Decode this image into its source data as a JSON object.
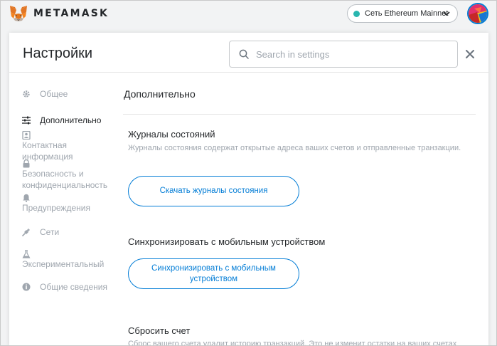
{
  "app": {
    "wordmark": "METAMASK"
  },
  "network": {
    "label": "Сеть Ethereum Mainnet",
    "status_color": "#29b6af"
  },
  "header": {
    "title": "Настройки",
    "search_placeholder": "Search in settings"
  },
  "sidebar": {
    "items": [
      {
        "label": "Общее",
        "icon": "gear-icon"
      },
      {
        "label": "Дополнительно",
        "icon": "sliders-icon"
      },
      {
        "label": "Контактная информация",
        "icon": "contacts-icon"
      },
      {
        "label": "Безопасность и конфиденциальность",
        "icon": "lock-icon"
      },
      {
        "label": "Предупреждения",
        "icon": "bell-icon"
      },
      {
        "label": "Сети",
        "icon": "plug-icon"
      },
      {
        "label": "Экспериментальный",
        "icon": "flask-icon"
      },
      {
        "label": "Общие сведения",
        "icon": "info-icon"
      }
    ]
  },
  "content": {
    "section_title": "Дополнительно",
    "state_logs": {
      "title": "Журналы состояний",
      "description": "Журналы состояния содержат открытые адреса ваших счетов и отправленные транзакции.",
      "button": "Скачать журналы состояния"
    },
    "mobile_sync": {
      "title": "Синхронизировать с мобильным устройством",
      "button": "Синхронизировать с мобильным устройством"
    },
    "reset_account": {
      "title": "Сбросить счет",
      "description": "Сброс вашего счета удалит историю транзакций. Это не изменит остатки на ваших счетах"
    }
  },
  "colors": {
    "accent": "#037dd6",
    "muted_text": "#9fa6ae",
    "text": "#24272a"
  }
}
